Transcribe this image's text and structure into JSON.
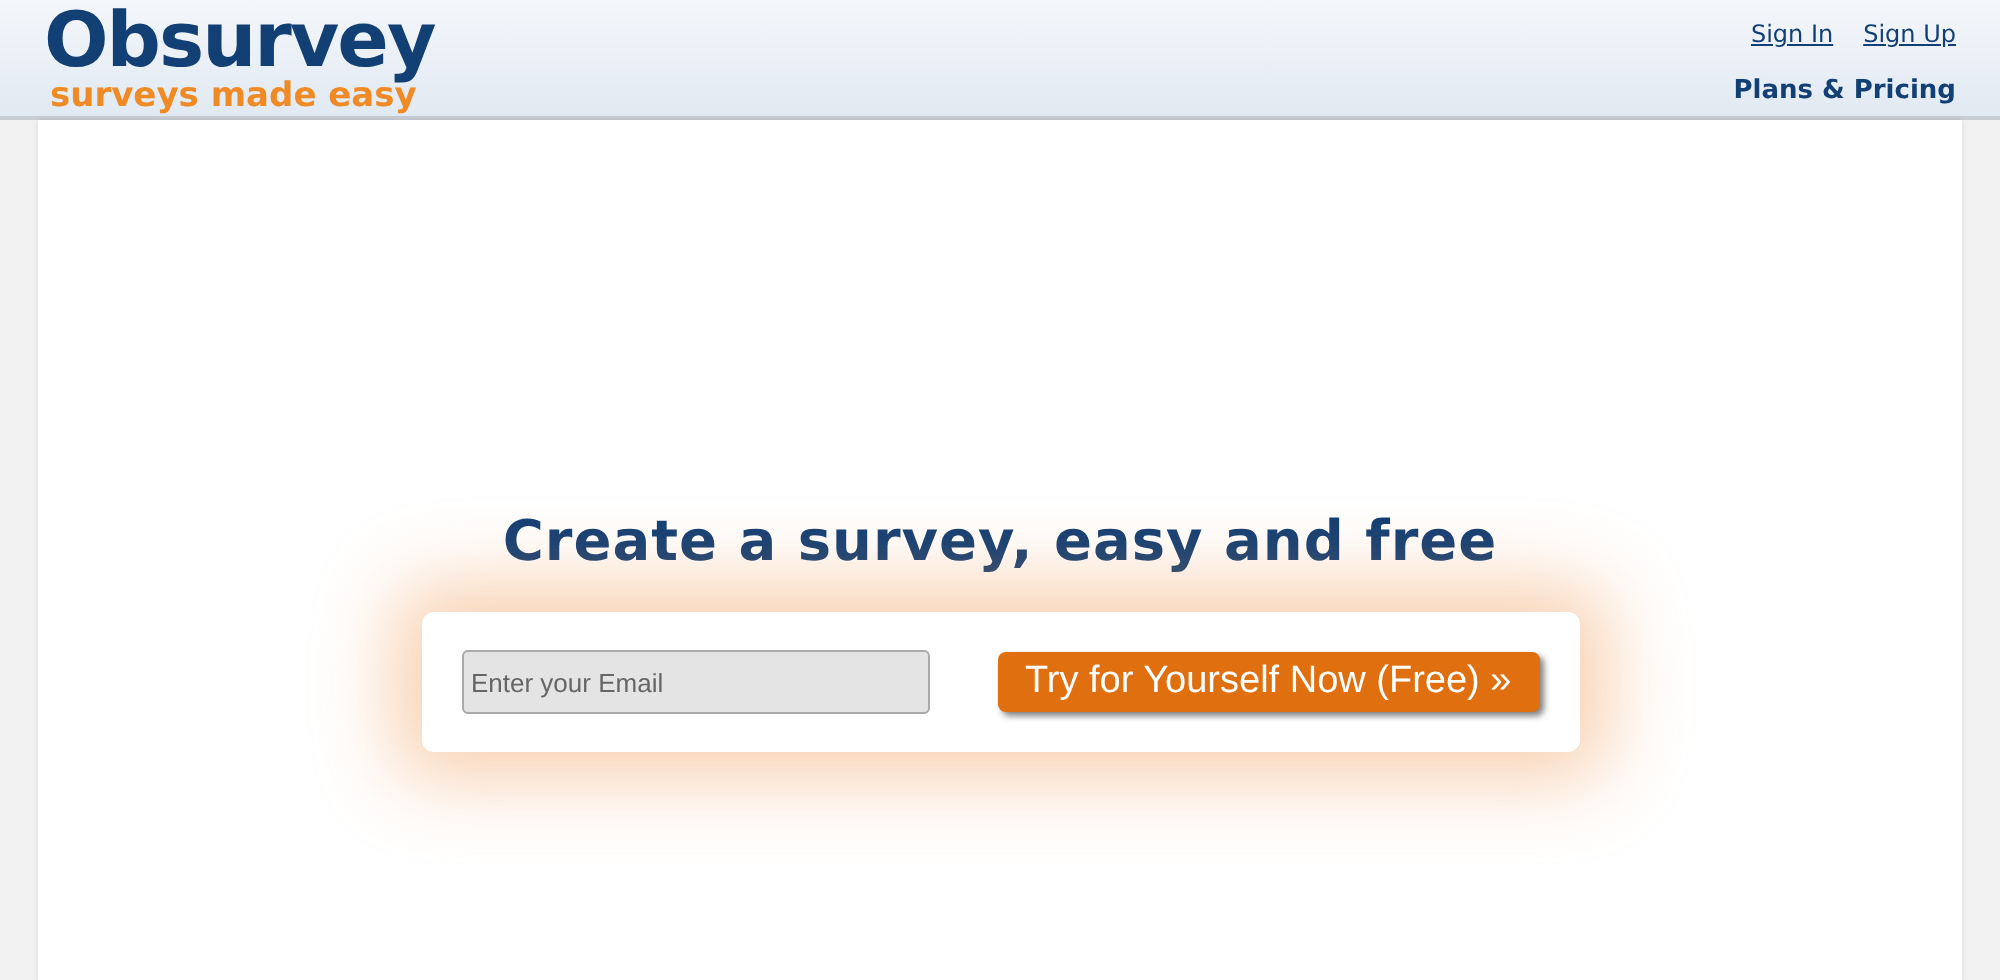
{
  "header": {
    "logo": "Obsurvey",
    "tagline": "surveys made easy",
    "links": [
      "Sign In",
      "Sign Up"
    ],
    "plans_link": "Plans & Pricing"
  },
  "hero": {
    "title": "Create a survey, easy and free",
    "email_field": {
      "placeholder": "Enter your Email"
    },
    "cta_button": "Try for Yourself Now (Free) »"
  }
}
